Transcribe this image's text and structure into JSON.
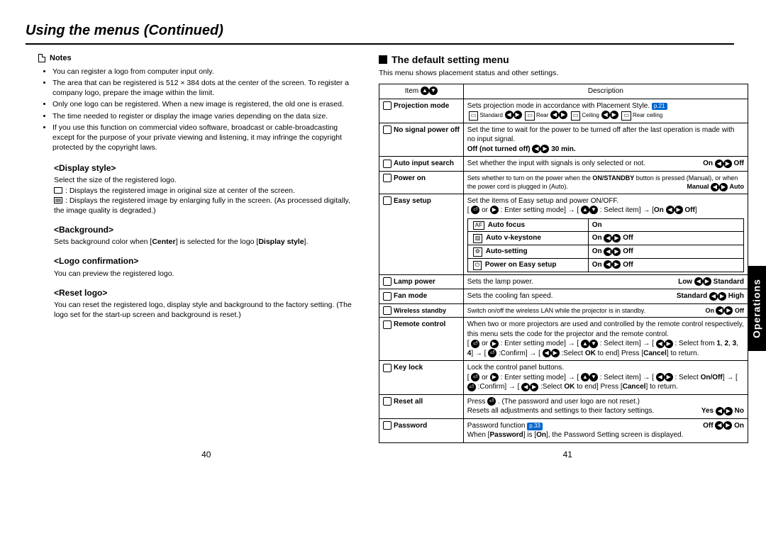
{
  "title": "Using the menus (Continued)",
  "side_tab": "Operations",
  "page_left": "40",
  "page_right": "41",
  "left": {
    "notes_label": "Notes",
    "notes": [
      "You can register a logo from computer input only.",
      "The area that can be registered is 512 × 384 dots at the center of the screen. To register a company logo, prepare the image within the limit.",
      "Only one logo can be registered. When a new image is registered, the old one is erased.",
      "The time needed to register or display the image varies depending on the data size.",
      "If you use this function on commercial video software, broadcast or cable-broadcasting except for the purpose of your private viewing and listening, it may infringe the copyright protected by the copyright laws."
    ],
    "display_style_h": "<Display style>",
    "display_style_intro": "Select the size of the registered logo.",
    "display_style_items": [
      "Displays the registered image in original size at center of the screen.",
      "Displays the registered image by enlarging fully in the screen. (As processed digitally, the image quality is degraded.)"
    ],
    "background_h": "<Background>",
    "background_t": "Sets background color when [Center] is selected for the logo [Display style].",
    "logoconf_h": "<Logo confirmation>",
    "logoconf_t": "You can preview the registered logo.",
    "reset_h": "<Reset logo>",
    "reset_t": "You can reset the registered logo, display style and background  to the factory setting. (The logo set for the start-up screen and background is reset.)"
  },
  "right": {
    "section_head": "The default setting menu",
    "intro": "This menu shows placement status and other settings.",
    "th_item": "Item",
    "th_desc": "Description",
    "rows": {
      "projection": {
        "label": "Projection mode",
        "desc": "Sets projection mode in accordance with Placement Style.",
        "pref": "p.21",
        "opts": [
          "Standard",
          "Rear",
          "Ceiling",
          "Rear ceiling"
        ]
      },
      "nosignal": {
        "label": "No signal power off",
        "desc": "Set the time to wait for the power to be turned off after the last operation is made with no input signal.",
        "off": "Off (not turned off)",
        "min": "30 min."
      },
      "autoinput": {
        "label": "Auto input search",
        "desc": "Set whether the input with signals is only selected or not.",
        "on": "On",
        "off": "Off"
      },
      "poweron": {
        "label": "Power on",
        "desc": "Sets whether to turn on the power when the ON/STANDBY button is pressed (Manual), or when the power cord is plugged in (Auto).",
        "manual": "Manual",
        "auto": "Auto"
      },
      "easysetup": {
        "label": "Easy setup",
        "desc": "Set the items of Easy setup and power ON/OFF.",
        "tail": "[ ⏎ or ▶ : Enter setting mode] → [ ▲▼ : Select item] → [On ◀▶ Off]",
        "inner": [
          {
            "l": "Auto focus",
            "r": "On"
          },
          {
            "l": "Auto v-keystone",
            "r": "On ◀▶ Off"
          },
          {
            "l": "Auto-setting",
            "r": "On ◀▶ Off"
          },
          {
            "l": "Power on Easy setup",
            "r": "On ◀▶ Off"
          }
        ]
      },
      "lamp": {
        "label": "Lamp power",
        "desc": "Sets the lamp power.",
        "low": "Low",
        "std": "Standard"
      },
      "fan": {
        "label": "Fan mode",
        "desc": "Sets the cooling fan speed.",
        "std": "Standard",
        "high": "High"
      },
      "wireless": {
        "label": "Wireless standby",
        "desc": "Switch on/off the wireless LAN while the projector is in standby.",
        "on": "On",
        "off": "Off"
      },
      "remote": {
        "label": "Remote control",
        "desc": "When two or more projectors are used and controlled by the remote control respectively, this menu sets the code for the projector and the remote control.",
        "line2": "[ ⏎ or ▶ : Enter setting mode] → [ ▲▼ : Select item] → [ ◀▶ : Select from 1, 2, 3, 4] → [ ⏎ :Confirm] → [ ◀▶ :Select OK to end] Press [Cancel] to return."
      },
      "keylock": {
        "label": "Key lock",
        "desc": "Lock the control panel buttons.",
        "line2": "[ ⏎ or ▶ : Enter setting mode] → [ ▲▼ : Select item] → [ ◀▶ : Select On/Off] → [ ⏎ :Confirm] → [ ◀▶ :Select OK to end] Press [Cancel] to return."
      },
      "resetall": {
        "label": "Reset all",
        "l1": "Press ⏎ . (The password and user logo are not reset.)",
        "l2": "Resets all adjustments and settings to their factory settings.",
        "yes": "Yes",
        "no": "No"
      },
      "password": {
        "label": "Password",
        "l1": "Password function",
        "pref": "p.33",
        "l2": "When [Password] is [On], the Password Setting screen is displayed.",
        "off": "Off",
        "on": "On"
      }
    }
  }
}
